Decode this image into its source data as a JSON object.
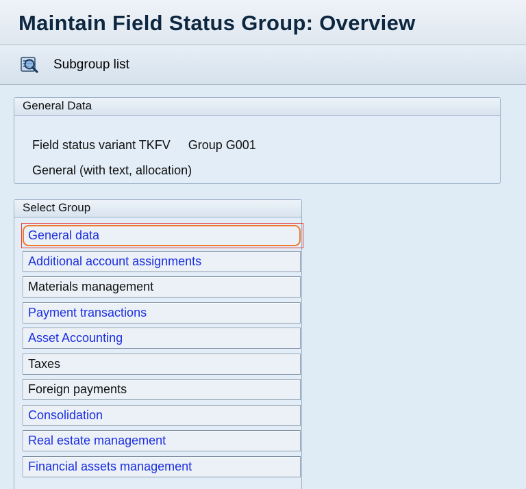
{
  "window": {
    "title": "Maintain Field Status Group: Overview"
  },
  "toolbar": {
    "subgroup_list_label": "Subgroup list",
    "subgroup_list_icon": "magnifier-list-icon"
  },
  "general_data": {
    "header": "General Data",
    "variant_text": "Field status variant TKFV",
    "group_text": "Group G001",
    "description": "General (with text, allocation)"
  },
  "select_group": {
    "header": "Select Group",
    "items": [
      {
        "label": "General data",
        "link": true,
        "selected": true
      },
      {
        "label": "Additional account assignments",
        "link": true
      },
      {
        "label": "Materials management",
        "link": false
      },
      {
        "label": "Payment transactions",
        "link": true
      },
      {
        "label": "Asset Accounting",
        "link": true
      },
      {
        "label": "Taxes",
        "link": false
      },
      {
        "label": "Foreign payments",
        "link": false
      },
      {
        "label": "Consolidation",
        "link": true
      },
      {
        "label": "Real estate management",
        "link": true
      },
      {
        "label": "Financial assets management",
        "link": true
      }
    ]
  },
  "colors": {
    "link": "#1c2ee0",
    "highlight": "#f07a2a",
    "background": "#dfebf5"
  }
}
